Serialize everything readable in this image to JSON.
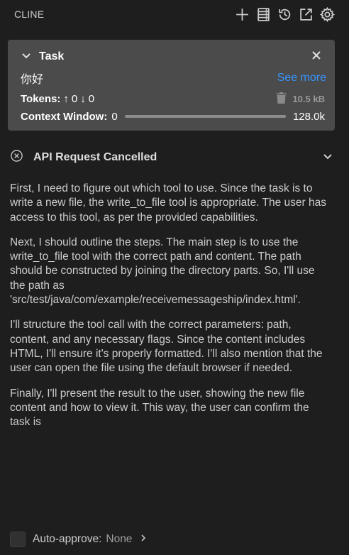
{
  "header": {
    "title": "CLINE",
    "icons": [
      "plus-icon",
      "server-icon",
      "history-icon",
      "popout-icon",
      "gear-icon"
    ]
  },
  "task": {
    "label": "Task",
    "text": "你好",
    "see_more": "See more",
    "tokens_label": "Tokens:",
    "tokens_up": "0",
    "tokens_down": "0",
    "size": "10.5 kB",
    "context_label": "Context Window:",
    "context_used": "0",
    "context_max": "128.0k",
    "context_fraction": 0
  },
  "api": {
    "title": "API Request Cancelled"
  },
  "message": {
    "p1": "First, I need to figure out which tool to use. Since the task is to write a new file, the write_to_file tool is appropriate. The user has access to this tool, as per the provided capabilities.",
    "p2": "Next, I should outline the steps. The main step is to use the write_to_file tool with the correct path and content. The path should be constructed by joining the directory parts. So, I'll use the path as 'src/test/java/com/example/receivemessageship/index.html'.",
    "p3": "I'll structure the tool call with the correct parameters: path, content, and any necessary flags. Since the content includes HTML, I'll ensure it's properly formatted. I'll also mention that the user can open the file using the default browser if needed.",
    "p4": "Finally, I'll present the result to the user, showing the new file content and how to view it. This way, the user can confirm the task is"
  },
  "footer": {
    "auto_approve_label": "Auto-approve:",
    "auto_approve_value": "None"
  }
}
